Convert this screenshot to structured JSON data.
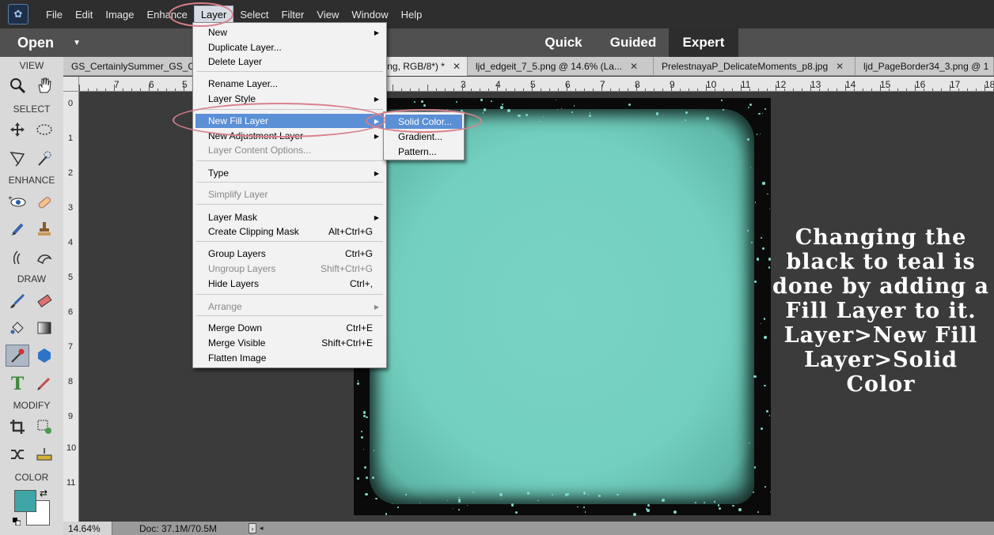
{
  "menubar": {
    "logo": "app-logo",
    "items": [
      "File",
      "Edit",
      "Image",
      "Enhance",
      "Layer",
      "Select",
      "Filter",
      "View",
      "Window",
      "Help"
    ],
    "active_item": "Layer"
  },
  "modebar": {
    "open_label": "Open",
    "tabs": [
      "Quick",
      "Guided",
      "Expert"
    ],
    "active_tab": "Expert"
  },
  "toolbox": {
    "sections": [
      "VIEW",
      "SELECT",
      "ENHANCE",
      "DRAW",
      "MODIFY",
      "COLOR"
    ],
    "foreground_color": "#3fa5a6",
    "background_color": "#ffffff"
  },
  "doc_tabs": [
    {
      "label": "GS_CertainlySummer_GS_C",
      "active": false
    },
    {
      "label": "ng, RGB/8*) *",
      "active": true
    },
    {
      "label": "ljd_edgeit_7_5.png @ 14.6% (La...",
      "active": false
    },
    {
      "label": "PrelestnayaP_DelicateMoments_p8.jpg",
      "active": false
    },
    {
      "label": "ljd_PageBorder34_3.png @ 1",
      "active": false
    }
  ],
  "ruler_top": [
    "7",
    "6",
    "5",
    "3",
    "4",
    "5",
    "6",
    "7",
    "8",
    "9",
    "10",
    "11",
    "12",
    "13",
    "14",
    "15",
    "16",
    "17",
    "18"
  ],
  "ruler_left": [
    "0",
    "1",
    "2",
    "3",
    "4",
    "5",
    "6",
    "7",
    "8",
    "9",
    "10",
    "11"
  ],
  "layer_menu": {
    "items": [
      {
        "label": "New",
        "submenu": true
      },
      {
        "label": "Duplicate Layer..."
      },
      {
        "label": "Delete Layer"
      },
      {
        "label": "Rename Layer..."
      },
      {
        "label": "Layer Style",
        "submenu": true
      },
      {
        "label": "New Fill Layer",
        "submenu": true,
        "highlighted": true
      },
      {
        "label": "New Adjustment Layer",
        "submenu": true
      },
      {
        "label": "Layer Content Options...",
        "disabled": true
      },
      {
        "label": "Type",
        "submenu": true
      },
      {
        "label": "Simplify Layer",
        "disabled": true
      },
      {
        "label": "Layer Mask",
        "submenu": true
      },
      {
        "label": "Create Clipping Mask",
        "shortcut": "Alt+Ctrl+G"
      },
      {
        "label": "Group Layers",
        "shortcut": "Ctrl+G"
      },
      {
        "label": "Ungroup Layers",
        "shortcut": "Shift+Ctrl+G",
        "disabled": true
      },
      {
        "label": "Hide Layers",
        "shortcut": "Ctrl+,"
      },
      {
        "label": "Arrange",
        "submenu": true,
        "disabled": true
      },
      {
        "label": "Merge Down",
        "shortcut": "Ctrl+E"
      },
      {
        "label": "Merge Visible",
        "shortcut": "Shift+Ctrl+E"
      },
      {
        "label": "Flatten Image"
      }
    ]
  },
  "fill_submenu": {
    "items": [
      "Solid Color...",
      "Gradient...",
      "Pattern..."
    ],
    "highlighted": "Solid Color..."
  },
  "annotation": "Changing the black to teal is done by adding a Fill Layer to it. Layer>New Fill Layer>Solid Color",
  "statusbar": {
    "zoom": "14.64%",
    "doc_size": "Doc: 37.1M/70.5M"
  },
  "colors": {
    "callout": "#d9808c",
    "highlight": "#5b8fd6",
    "teal": "#73cfbf"
  }
}
